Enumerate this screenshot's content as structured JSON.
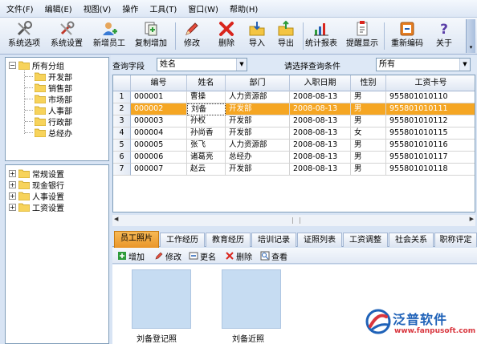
{
  "menu": [
    "文件(F)",
    "编辑(E)",
    "视图(V)",
    "操作",
    "工具(T)",
    "窗口(W)",
    "帮助(H)"
  ],
  "toolbar": [
    {
      "label": "系统选项",
      "icon": "tools-icon"
    },
    {
      "label": "系统设置",
      "icon": "wrench-icon"
    },
    {
      "label": "新增员工",
      "icon": "add-user-icon"
    },
    {
      "label": "复制增加",
      "icon": "copy-add-icon"
    },
    {
      "label": "修改",
      "icon": "pencil-icon"
    },
    {
      "label": "删除",
      "icon": "delete-x-icon"
    },
    {
      "label": "导入",
      "icon": "import-icon"
    },
    {
      "label": "导出",
      "icon": "export-icon"
    },
    {
      "label": "统计报表",
      "icon": "chart-report-icon"
    },
    {
      "label": "提醒显示",
      "icon": "reminder-icon"
    },
    {
      "label": "重新编码",
      "icon": "recode-icon"
    },
    {
      "label": "关于",
      "icon": "help-icon"
    }
  ],
  "dept_tree": {
    "root": "所有分组",
    "children": [
      "开发部",
      "销售部",
      "市场部",
      "人事部",
      "行政部",
      "总经办"
    ]
  },
  "settings_tree": [
    "常规设置",
    "现金银行",
    "人事设置",
    "工资设置"
  ],
  "query": {
    "field_label": "查询字段",
    "field_value": "姓名",
    "condition_label": "请选择查询条件",
    "condition_value": "所有"
  },
  "grid": {
    "columns": [
      "编号",
      "姓名",
      "部门",
      "入职日期",
      "性别",
      "工资卡号"
    ],
    "rows": [
      {
        "num": "1",
        "id": "000001",
        "name": "曹操",
        "dept": "人力资源部",
        "date": "2008-08-13",
        "gender": "男",
        "card": "955801010110"
      },
      {
        "num": "2",
        "id": "000002",
        "name": "刘备",
        "dept": "开发部",
        "date": "2008-08-13",
        "gender": "男",
        "card": "955801010111"
      },
      {
        "num": "3",
        "id": "000003",
        "name": "孙权",
        "dept": "开发部",
        "date": "2008-08-13",
        "gender": "男",
        "card": "955801010112"
      },
      {
        "num": "4",
        "id": "000004",
        "name": "孙尚香",
        "dept": "开发部",
        "date": "2008-08-13",
        "gender": "女",
        "card": "955801010115"
      },
      {
        "num": "5",
        "id": "000005",
        "name": "张飞",
        "dept": "人力资源部",
        "date": "2008-08-13",
        "gender": "男",
        "card": "955801010116"
      },
      {
        "num": "6",
        "id": "000006",
        "name": "诸葛亮",
        "dept": "总经办",
        "date": "2008-08-13",
        "gender": "男",
        "card": "955801010117"
      },
      {
        "num": "7",
        "id": "000007",
        "name": "赵云",
        "dept": "开发部",
        "date": "2008-08-13",
        "gender": "男",
        "card": "955801010118"
      }
    ]
  },
  "tabs": [
    "员工照片",
    "工作经历",
    "教育经历",
    "培训记录",
    "证照列表",
    "工资调整",
    "社会关系",
    "职称评定"
  ],
  "photo_toolbar": [
    {
      "label": "增加",
      "icon": "add-icon"
    },
    {
      "label": "修改",
      "icon": "edit-icon"
    },
    {
      "label": "更名",
      "icon": "rename-icon"
    },
    {
      "label": "删除",
      "icon": "delete-icon"
    },
    {
      "label": "查看",
      "icon": "view-icon"
    }
  ],
  "photos": [
    "刘备登记照",
    "刘备近照"
  ],
  "watermark": {
    "title": "泛普软件",
    "url": "www.fanpusoft.com"
  },
  "colors": {
    "selection": "#f5a623",
    "accent_blue": "#1f62b8",
    "accent_red": "#d9363e"
  }
}
